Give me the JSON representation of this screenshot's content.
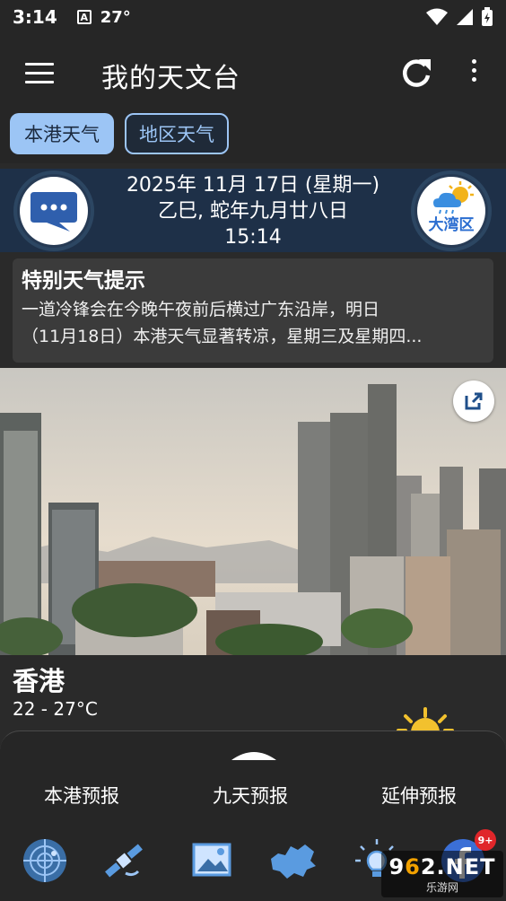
{
  "status_bar": {
    "time": "3:14",
    "temperature": "27°",
    "notification_letter": "A"
  },
  "app_bar": {
    "title": "我的天文台"
  },
  "tabs": [
    {
      "label": "本港天气",
      "active": true
    },
    {
      "label": "地区天气",
      "active": false
    }
  ],
  "date_banner": {
    "gregorian": "2025年 11月 17日 (星期一)",
    "lunar": "乙巳, 蛇年九月廿八日",
    "time": "15:14",
    "gba_label": "大湾区"
  },
  "special_warning": {
    "title": "特别天气提示",
    "line1": "一道冷锋会在今晚午夜前后横过广东沿岸，明日",
    "line2": "（11月18日）本港天气显著转凉，星期三及星期四..."
  },
  "location": {
    "name": "香港",
    "temp_range": "22 - 27°C"
  },
  "bottom_sheet": {
    "forecast_tabs": [
      "本港预报",
      "九天预报",
      "延伸预报"
    ],
    "nav_icons": [
      "radar-icon",
      "satellite-icon",
      "image-icon",
      "hong-kong-map-icon",
      "lightbulb-icon",
      "facebook-icon"
    ],
    "badge": "9+"
  },
  "watermark": {
    "brand_a": "9",
    "brand_o": "6",
    "brand_b": "2.NET",
    "sub": "乐游网"
  },
  "colors": {
    "accent": "#9cc5f5",
    "banner": "#1e3048",
    "card": "#3b3b3b",
    "background": "#2a2a2a"
  }
}
